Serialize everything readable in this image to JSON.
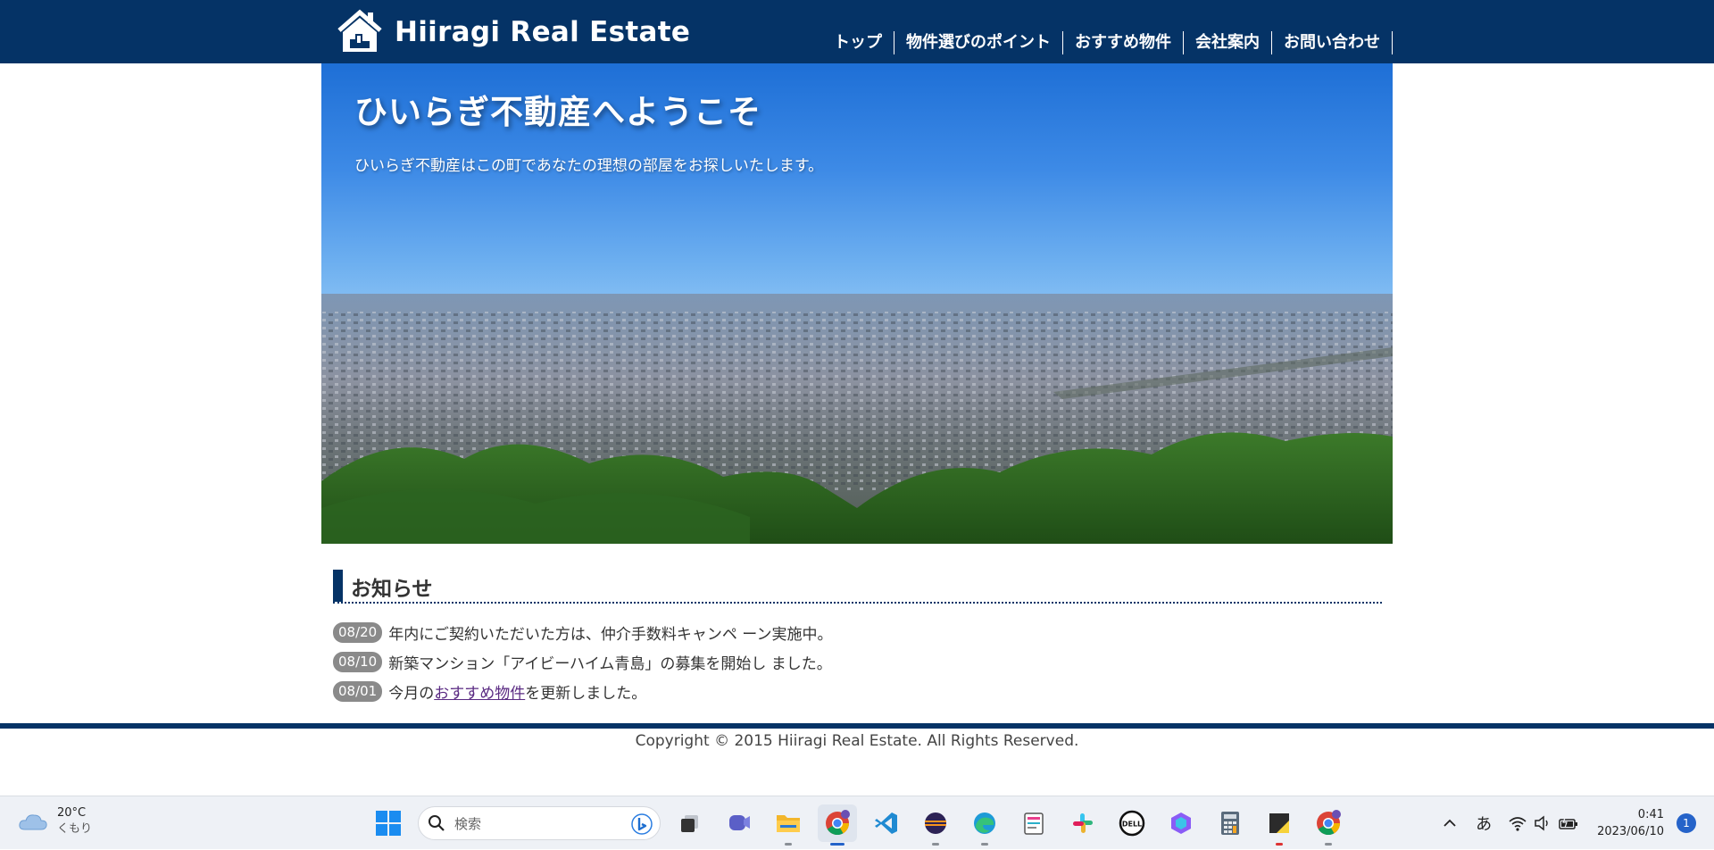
{
  "site": {
    "logo_text": "Hiiragi Real Estate",
    "nav": [
      {
        "label": "トップ"
      },
      {
        "label": "物件選びのポイント"
      },
      {
        "label": "おすすめ物件"
      },
      {
        "label": "会社案内"
      },
      {
        "label": "お問い合わせ"
      }
    ]
  },
  "hero": {
    "title": "ひいらぎ不動産へようこそ",
    "subtitle": "ひいらぎ不動産はこの町であなたの理想の部屋をお探しいたします。"
  },
  "news": {
    "heading": "お知らせ",
    "items": [
      {
        "date": "08/20",
        "text": "年内にご契約いただいた方は、仲介手数料キャンペ ーン実施中。"
      },
      {
        "date": "08/10",
        "text": "新築マンション「アイビーハイム青島」の募集を開始し ました。"
      },
      {
        "date": "08/01",
        "text_before": "今月の",
        "link": "おすすめ物件",
        "text_after": "を更新しました。"
      }
    ]
  },
  "footer": {
    "copyright": "Copyright © 2015 Hiiragi Real Estate. All Rights Reserved."
  },
  "taskbar": {
    "weather_temp": "20°C",
    "weather_cond": "くもり",
    "search_placeholder": "検索",
    "ime": "あ",
    "time": "0:41",
    "date": "2023/06/10",
    "notifications": "1",
    "apps": [
      "file-explorer-gray",
      "teams",
      "file-explorer",
      "chrome",
      "vscode",
      "eclipse",
      "edge",
      "notepad-app",
      "slack",
      "dell",
      "copilot",
      "calculator",
      "sticky-notes",
      "chrome-profile"
    ]
  },
  "colors": {
    "brand": "#053366",
    "badge": "#8a8a8a",
    "link": "#5a2a82",
    "taskbar_accent": "#2563c9"
  }
}
